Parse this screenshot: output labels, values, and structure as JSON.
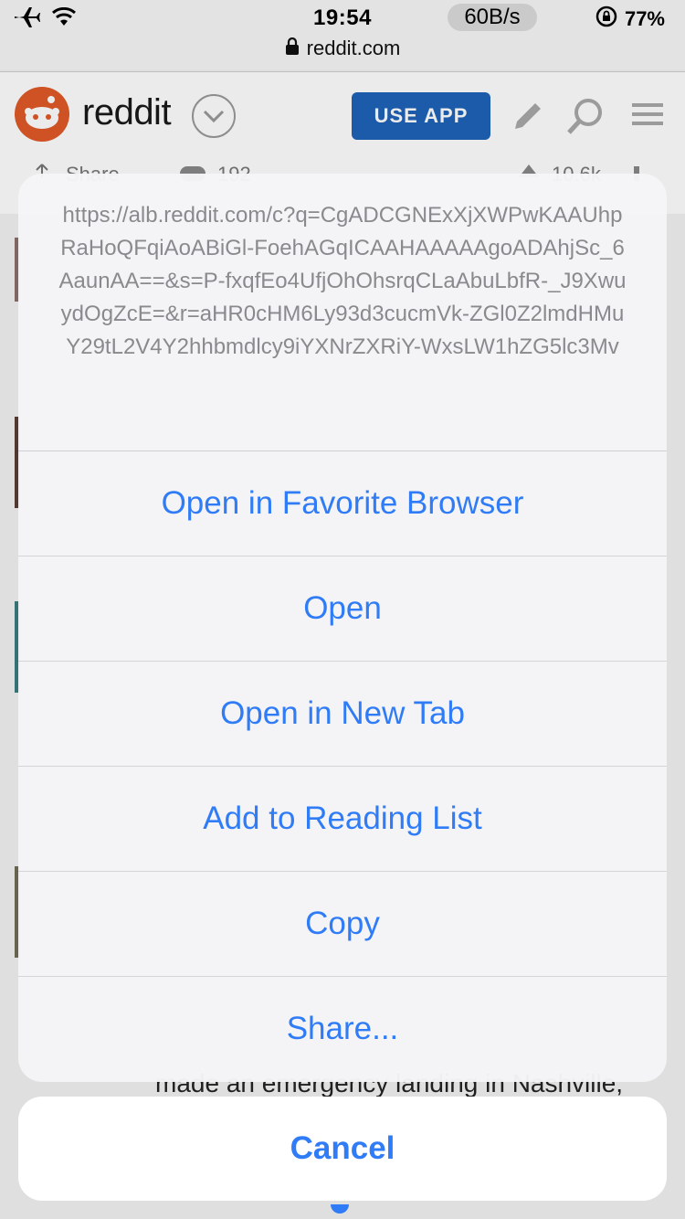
{
  "status_bar": {
    "time": "19:54",
    "speed": "60B/s",
    "battery": "77%",
    "airplane_icon": "airplane-icon",
    "wifi_icon": "wifi-icon",
    "orientation_lock_icon": "orientation-lock-icon",
    "battery_icon": "battery-icon"
  },
  "url_bar": {
    "domain": "reddit.com",
    "icon": "lock-icon"
  },
  "header": {
    "brand": "reddit",
    "use_app_label": "USE APP",
    "icons": [
      "reddit-alien-icon",
      "chevron-down-icon",
      "pencil-icon",
      "search-icon",
      "menu-icon"
    ]
  },
  "background": {
    "share_label": "Share",
    "comment_count": "192",
    "vote_count": "10.6k",
    "post_snippet": "made an emergency landing in Nashville,"
  },
  "action_sheet": {
    "link_url": "https://alb.reddit.com/c?q=CgADCGNExXjXWPwKAAUhpRaHoQFqiAoABiGl-FoehAGqICAAHAAAAAgoADAhjSc_6AaunAA==&s=P-fxqfEo4UfjOhOhsrqCLaAbuLbfR-_J9XwuydOgZcE=&r=aHR0cHM6Ly93d3cucmVk-ZGl0Z2lmdHMuY29tL2V4Y2hhbmdlcy9iYXNrZXRiY-WxsLW1hZG5lc3Mv",
    "items": [
      {
        "label": "Open in Favorite Browser"
      },
      {
        "label": "Open"
      },
      {
        "label": "Open in New Tab"
      },
      {
        "label": "Add to Reading List"
      },
      {
        "label": "Copy"
      },
      {
        "label": "Share..."
      }
    ],
    "cancel_label": "Cancel"
  },
  "colors": {
    "accent": "#2f7cf6",
    "reddit_orange": "#e05a26",
    "use_app_blue": "#1f63b8"
  }
}
